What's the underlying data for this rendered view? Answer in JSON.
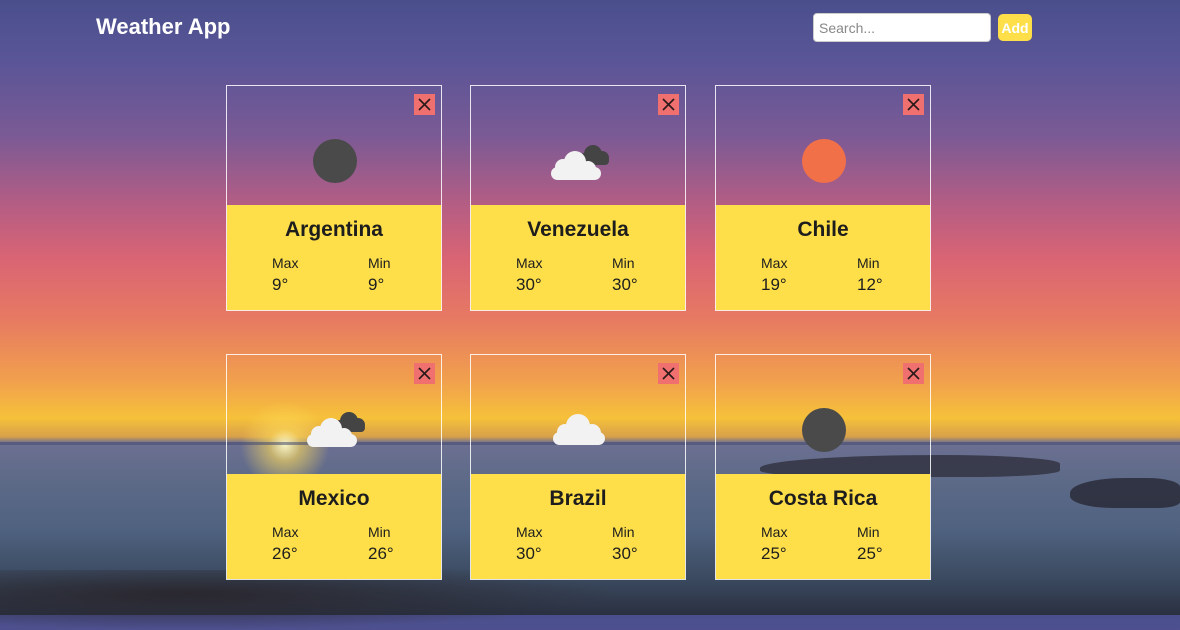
{
  "header": {
    "title": "Weather App",
    "search_placeholder": "Search...",
    "add_label": "Add"
  },
  "labels": {
    "max": "Max",
    "min": "Min"
  },
  "colors": {
    "accent": "#fedf49",
    "close": "#f06f6f",
    "icon_dark": "#4a4a4a",
    "icon_sun": "#f17048"
  },
  "cities": [
    {
      "name": "Argentina",
      "max": "9°",
      "min": "9°",
      "icon": "dark-circle-icon"
    },
    {
      "name": "Venezuela",
      "max": "30°",
      "min": "30°",
      "icon": "cloud-dark-cloud-icon"
    },
    {
      "name": "Chile",
      "max": "19°",
      "min": "12°",
      "icon": "sun-icon"
    },
    {
      "name": "Mexico",
      "max": "26°",
      "min": "26°",
      "icon": "cloud-dark-cloud-icon"
    },
    {
      "name": "Brazil",
      "max": "30°",
      "min": "30°",
      "icon": "cloud-icon"
    },
    {
      "name": "Costa Rica",
      "max": "25°",
      "min": "25°",
      "icon": "dark-circle-icon"
    }
  ]
}
